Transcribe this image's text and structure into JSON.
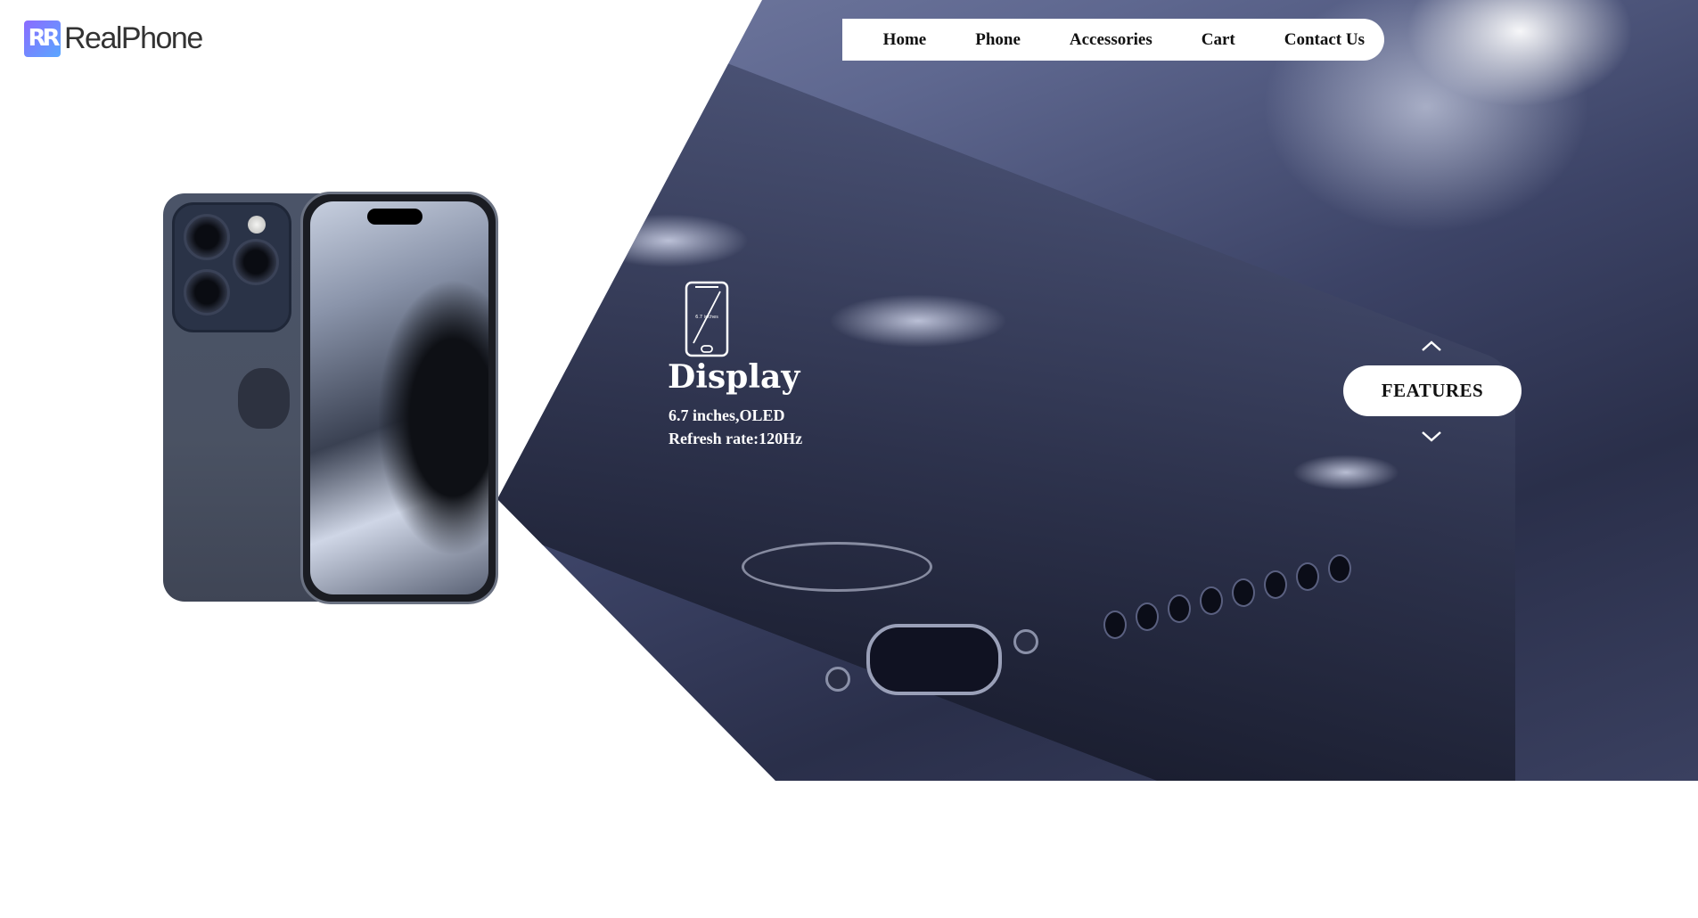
{
  "brand": {
    "logo_mark": "R",
    "name": "RealPhone"
  },
  "nav": {
    "items": [
      {
        "label": "Home"
      },
      {
        "label": "Phone"
      },
      {
        "label": "Accessories"
      },
      {
        "label": "Cart"
      },
      {
        "label": "Contact Us"
      }
    ]
  },
  "feature": {
    "icon": "phone-screen-icon",
    "icon_caption": "6.7 inches",
    "title": "Display",
    "lines": [
      "6.7 inches,OLED",
      "Refresh rate:120Hz"
    ]
  },
  "features_control": {
    "label": "FEATURES",
    "up_icon": "chevron-up-icon",
    "down_icon": "chevron-down-icon"
  },
  "colors": {
    "accent_gradient_start": "#8b6bff",
    "accent_gradient_end": "#5aa7ff",
    "hero_dark": "#2a2f4a"
  }
}
